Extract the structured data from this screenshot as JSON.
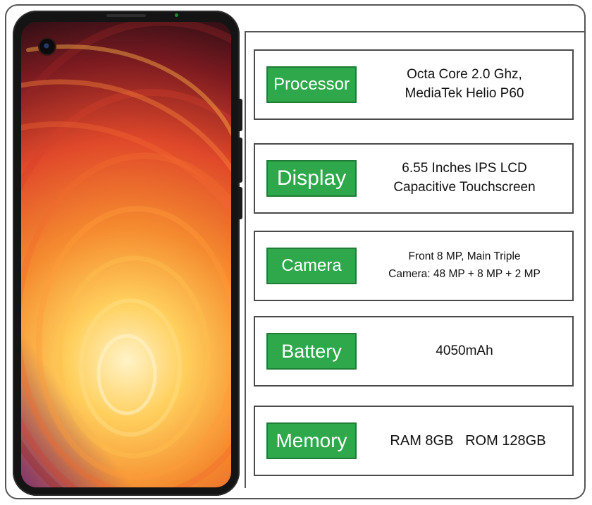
{
  "specs": [
    {
      "label": "Processor",
      "lines": [
        "Octa Core 2.0 Ghz,",
        "MediaTek Helio P60"
      ]
    },
    {
      "label": "Display",
      "lines": [
        "6.55 Inches IPS LCD",
        "Capacitive Touchscreen"
      ]
    },
    {
      "label": "Camera",
      "lines": [
        "Front  8 MP,  Main  Triple",
        "Camera: 48 MP + 8 MP + 2 MP"
      ]
    },
    {
      "label": "Battery",
      "lines": [
        "4050mAh"
      ]
    },
    {
      "label": "Memory",
      "lines": [
        "RAM 8GB   ROM 128GB"
      ]
    }
  ],
  "colors": {
    "label_green": "#2fa84c",
    "border": "#4a4a4a",
    "phone_body": "#141414",
    "wallpaper": [
      "#1d0c12",
      "#7a1a20",
      "#e0482a",
      "#f58c2f",
      "#ffcf5c",
      "#fff3c8"
    ]
  },
  "icons": [
    "front-camera-icon"
  ]
}
